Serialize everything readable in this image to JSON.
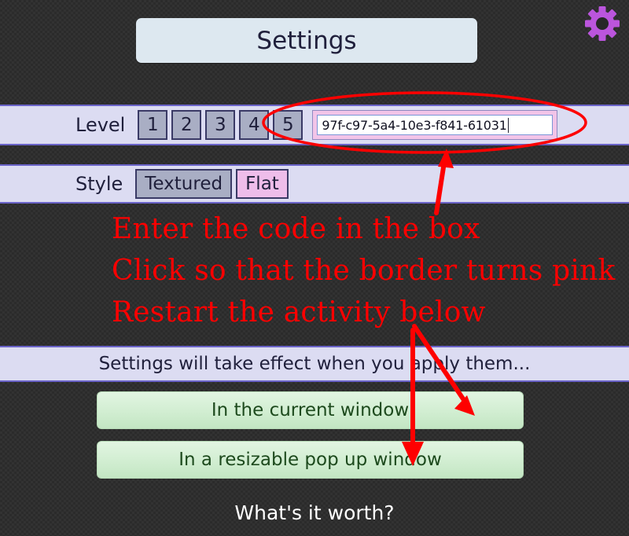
{
  "window": {
    "title": "Settings",
    "gear_icon": "gear-icon",
    "accent_purple": "#bb55dd",
    "row_background": "#dcdcf2",
    "row_border": "#6a63c8",
    "annotation_color": "#fe0000"
  },
  "settings": {
    "level": {
      "label": "Level",
      "options": [
        "1",
        "2",
        "3",
        "4",
        "5"
      ],
      "code_input": {
        "value": "97f-c97-5a4-10e3-f841-61031",
        "placeholder": "",
        "border_color": "#f2c4e8",
        "has_caret": true
      }
    },
    "style": {
      "label": "Style",
      "options": [
        {
          "label": "Textured",
          "selected": true
        },
        {
          "label": "Flat",
          "selected": false
        }
      ]
    }
  },
  "apply": {
    "note": "Settings will take effect when you apply them...",
    "buttons": [
      "In the current window",
      "In a resizable pop up window"
    ]
  },
  "footer": {
    "text": "What's it worth?"
  },
  "annotations": {
    "lines": [
      "Enter the code in the box",
      "Click so that the border turns pink",
      "Restart the activity below"
    ],
    "shapes": [
      "ellipse-around-code-input",
      "arrow-up-to-code-input",
      "arrow-diagonal-to-current-window-button",
      "arrow-down-to-popup-window-button"
    ]
  }
}
